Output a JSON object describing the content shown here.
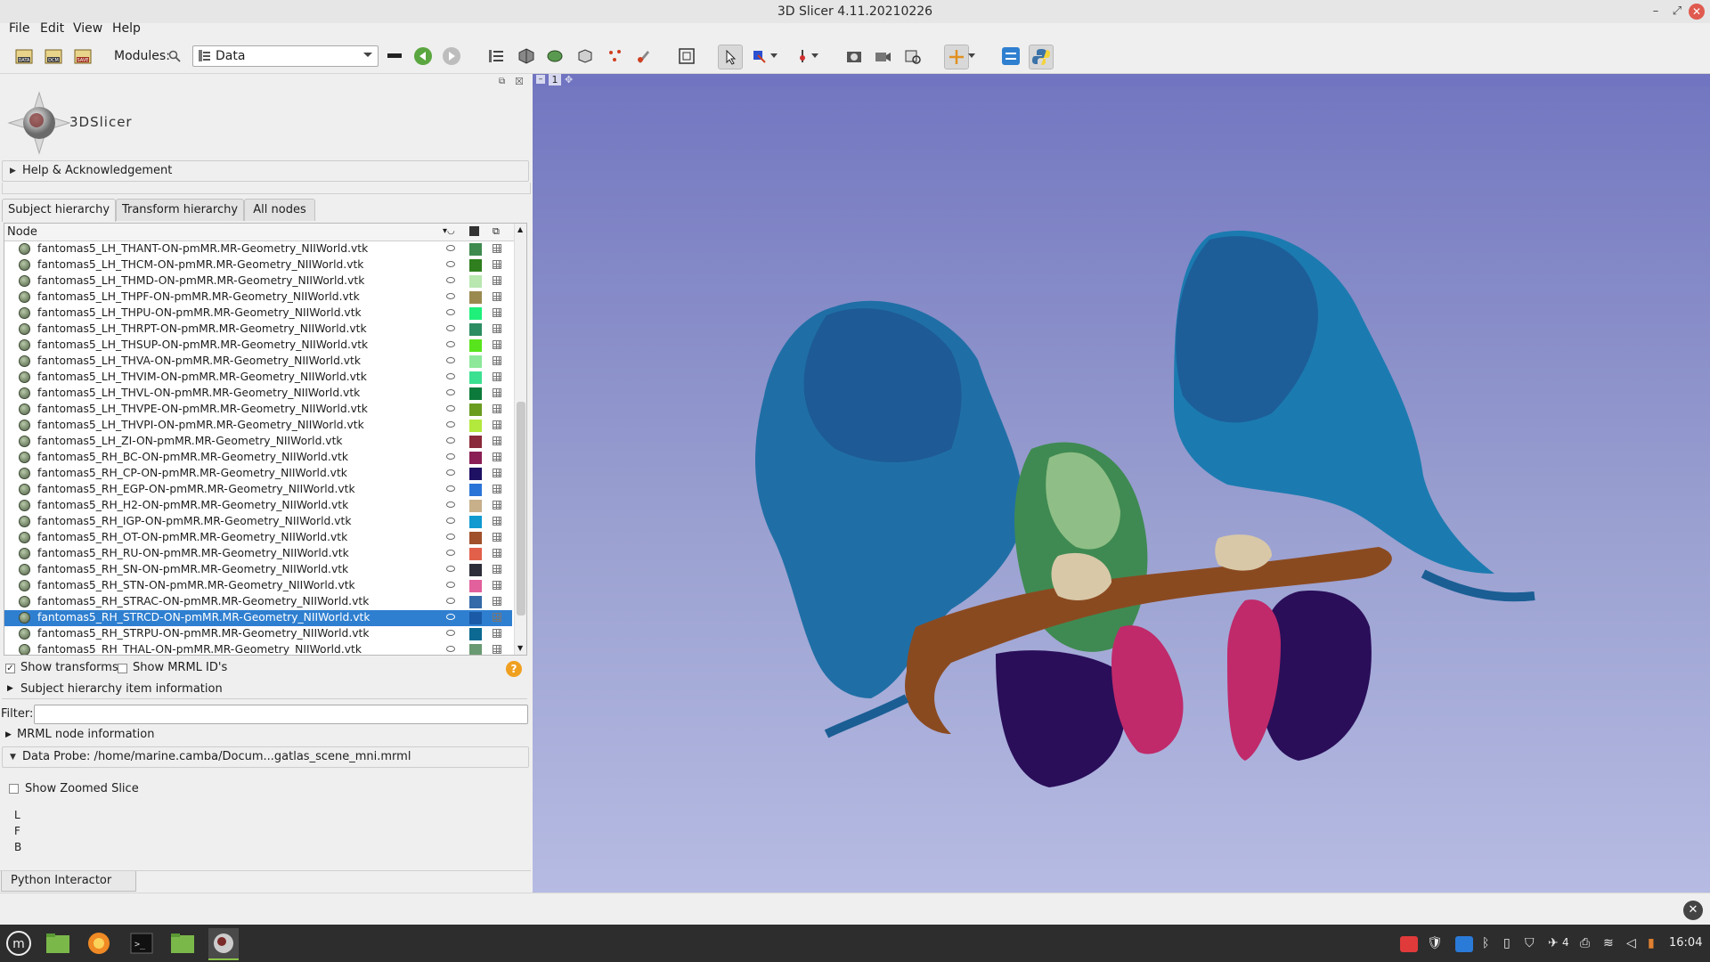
{
  "window": {
    "title": "3D Slicer 4.11.20210226",
    "minimize": "–",
    "restore": "⤢",
    "close": "✕"
  },
  "menubar": [
    "File",
    "Edit",
    "View",
    "Help"
  ],
  "toolbar": {
    "modules_label": "Modules:",
    "module_selected": "Data",
    "icons": [
      "data-load-icon",
      "dicom-icon",
      "save-icon",
      "search-icon",
      "layout-icon",
      "back-arrow-icon",
      "forward-arrow-icon"
    ]
  },
  "logo": {
    "text": "3DSlicer"
  },
  "sections": {
    "help": "Help & Acknowledgement",
    "subject_item_info": "Subject hierarchy item information",
    "mrml_info": "MRML node information",
    "data_probe": "Data Probe: /home/marine.camba/Docum...gatlas_scene_mni.mrml"
  },
  "tabs": [
    {
      "label": "Subject hierarchy",
      "active": true
    },
    {
      "label": "Transform hierarchy",
      "active": false
    },
    {
      "label": "All nodes",
      "active": false
    }
  ],
  "tree": {
    "header": "Node",
    "rows": [
      {
        "name": "fantomas5_LH_THANT-ON-pmMR.MR-Geometry_NIIWorld.vtk",
        "color": "#3e8a4f"
      },
      {
        "name": "fantomas5_LH_THCM-ON-pmMR.MR-Geometry_NIIWorld.vtk",
        "color": "#2f7f1e"
      },
      {
        "name": "fantomas5_LH_THMD-ON-pmMR.MR-Geometry_NIIWorld.vtk",
        "color": "#b8e7b0"
      },
      {
        "name": "fantomas5_LH_THPF-ON-pmMR.MR-Geometry_NIIWorld.vtk",
        "color": "#9b8a50"
      },
      {
        "name": "fantomas5_LH_THPU-ON-pmMR.MR-Geometry_NIIWorld.vtk",
        "color": "#1ef07a"
      },
      {
        "name": "fantomas5_LH_THRPT-ON-pmMR.MR-Geometry_NIIWorld.vtk",
        "color": "#2c8c62"
      },
      {
        "name": "fantomas5_LH_THSUP-ON-pmMR.MR-Geometry_NIIWorld.vtk",
        "color": "#58e41c"
      },
      {
        "name": "fantomas5_LH_THVA-ON-pmMR.MR-Geometry_NIIWorld.vtk",
        "color": "#8de89a"
      },
      {
        "name": "fantomas5_LH_THVIM-ON-pmMR.MR-Geometry_NIIWorld.vtk",
        "color": "#3ce091"
      },
      {
        "name": "fantomas5_LH_THVL-ON-pmMR.MR-Geometry_NIIWorld.vtk",
        "color": "#0c7a3a"
      },
      {
        "name": "fantomas5_LH_THVPE-ON-pmMR.MR-Geometry_NIIWorld.vtk",
        "color": "#6a9c20"
      },
      {
        "name": "fantomas5_LH_THVPI-ON-pmMR.MR-Geometry_NIIWorld.vtk",
        "color": "#b3e83c"
      },
      {
        "name": "fantomas5_LH_ZI-ON-pmMR.MR-Geometry_NIIWorld.vtk",
        "color": "#8a2a3a"
      },
      {
        "name": "fantomas5_RH_BC-ON-pmMR.MR-Geometry_NIIWorld.vtk",
        "color": "#8a1f55"
      },
      {
        "name": "fantomas5_RH_CP-ON-pmMR.MR-Geometry_NIIWorld.vtk",
        "color": "#1e1062"
      },
      {
        "name": "fantomas5_RH_EGP-ON-pmMR.MR-Geometry_NIIWorld.vtk",
        "color": "#2a74d8"
      },
      {
        "name": "fantomas5_RH_H2-ON-pmMR.MR-Geometry_NIIWorld.vtk",
        "color": "#c7b08a"
      },
      {
        "name": "fantomas5_RH_IGP-ON-pmMR.MR-Geometry_NIIWorld.vtk",
        "color": "#109ad0"
      },
      {
        "name": "fantomas5_RH_OT-ON-pmMR.MR-Geometry_NIIWorld.vtk",
        "color": "#a0502a"
      },
      {
        "name": "fantomas5_RH_RU-ON-pmMR.MR-Geometry_NIIWorld.vtk",
        "color": "#e2604a"
      },
      {
        "name": "fantomas5_RH_SN-ON-pmMR.MR-Geometry_NIIWorld.vtk",
        "color": "#2e2e3a"
      },
      {
        "name": "fantomas5_RH_STN-ON-pmMR.MR-Geometry_NIIWorld.vtk",
        "color": "#e2609c"
      },
      {
        "name": "fantomas5_RH_STRAC-ON-pmMR.MR-Geometry_NIIWorld.vtk",
        "color": "#346aa8"
      },
      {
        "name": "fantomas5_RH_STRCD-ON-pmMR.MR-Geometry_NIIWorld.vtk",
        "color": "#1a5aa6",
        "selected": true
      },
      {
        "name": "fantomas5_RH_STRPU-ON-pmMR.MR-Geometry_NIIWorld.vtk",
        "color": "#0c6a92"
      },
      {
        "name": "fantomas5_RH_THAL-ON-pmMR.MR-Geometry_NIIWorld.vtk",
        "color": "#6a9a72"
      }
    ]
  },
  "options": {
    "show_transforms": "Show transforms",
    "show_mrml_ids": "Show MRML ID's"
  },
  "filter_label": "Filter:",
  "show_zoomed_slice": "Show Zoomed Slice",
  "probe_values": [
    "L",
    "F",
    "B"
  ],
  "python_interactor": "Python Interactor",
  "view": {
    "number": "1"
  },
  "taskbar": {
    "time": "16:04",
    "notify_count": "4"
  }
}
